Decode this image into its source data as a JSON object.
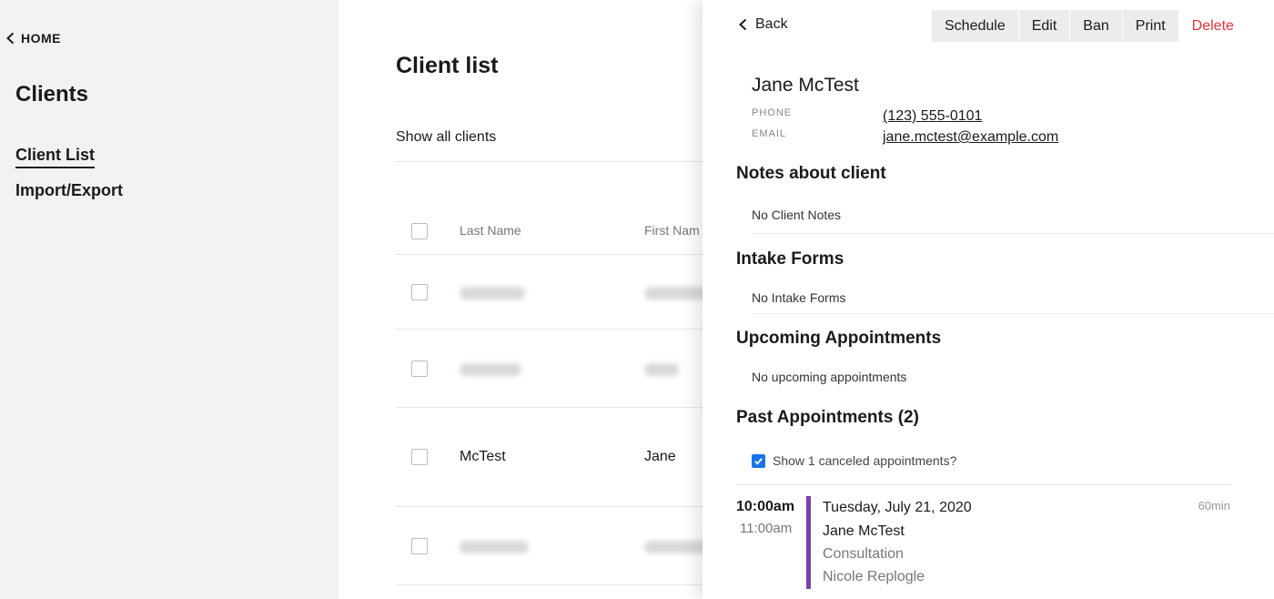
{
  "sidebar": {
    "home_label": "HOME",
    "title": "Clients",
    "nav": [
      {
        "label": "Client List",
        "active": true
      },
      {
        "label": "Import/Export",
        "active": false
      }
    ]
  },
  "main": {
    "title": "Client list",
    "filter_label": "Show all clients",
    "columns": {
      "last": "Last Name",
      "first": "First Nam"
    },
    "rows": [
      {
        "last": "",
        "first": "",
        "blurred": true
      },
      {
        "last": "",
        "first": "",
        "blurred": true
      },
      {
        "last": "McTest",
        "first": "Jane",
        "blurred": false
      },
      {
        "last": "",
        "first": "",
        "blurred": true
      }
    ]
  },
  "drawer": {
    "back_label": "Back",
    "toolbar": {
      "schedule": "Schedule",
      "edit": "Edit",
      "ban": "Ban",
      "print": "Print",
      "delete": "Delete"
    },
    "client": {
      "name": "Jane McTest",
      "phone_label": "PHONE",
      "phone": "(123) 555-0101",
      "email_label": "EMAIL",
      "email": "jane.mctest@example.com"
    },
    "notes": {
      "title": "Notes about client",
      "text": "No Client Notes"
    },
    "intake": {
      "title": "Intake Forms",
      "text": "No Intake Forms"
    },
    "upcoming": {
      "title": "Upcoming Appointments",
      "text": "No upcoming appointments"
    },
    "past": {
      "title": "Past Appointments (2)",
      "show_canceled_label": "Show 1 canceled appointments?",
      "show_canceled_checked": true,
      "appointments": [
        {
          "start": "10:00am",
          "end": "11:00am",
          "date": "Tuesday, July 21, 2020",
          "client": "Jane McTest",
          "type": "Consultation",
          "staff": "Nicole Replogle",
          "duration": "60min",
          "color": "#7b3fb0"
        }
      ]
    }
  },
  "colors": {
    "delete": "#e0333b",
    "checkbox": "#1a73e8",
    "appointment_bar": "#7b3fb0"
  }
}
